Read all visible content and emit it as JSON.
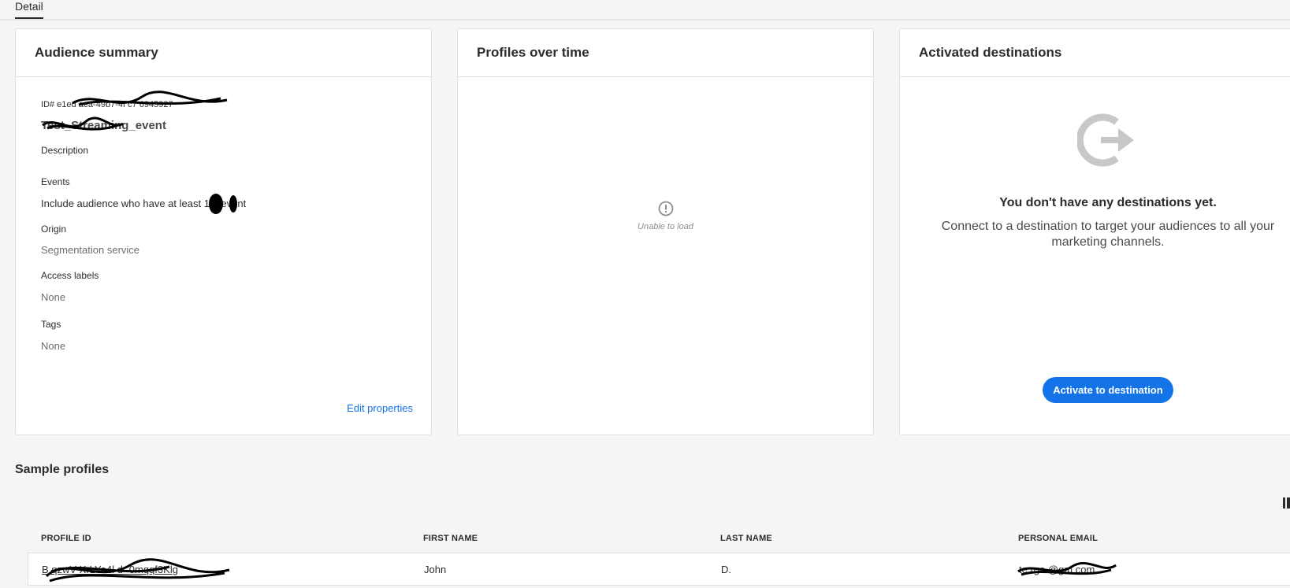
{
  "tabs": {
    "active": "Detail"
  },
  "audience_summary": {
    "title": "Audience summary",
    "id_text": "ID# e1ed    aea-49b7-4f    c7      6945927",
    "name": "       Test_Streaming_event",
    "description_label": "Description",
    "events_label": "Events",
    "events_value": "Include audience who have at least 1          g event",
    "origin_label": "Origin",
    "origin_value": "Segmentation service",
    "access_labels_label": "Access labels",
    "access_labels_value": "None",
    "tags_label": "Tags",
    "tags_value": "None",
    "edit_link": "Edit properties"
  },
  "profiles_over_time": {
    "title": "Profiles over time",
    "error_icon": "alert-circle-icon",
    "error_text": "Unable to load"
  },
  "activated_destinations": {
    "title": "Activated destinations",
    "icon": "destination-export-icon",
    "empty_title": "You don't have any destinations yet.",
    "empty_text": "Connect to a destination to target your audiences to all your marketing channels.",
    "activate_button": "Activate to destination"
  },
  "sample_profiles": {
    "title": "Sample profiles",
    "columns": [
      "PROFILE ID",
      "FIRST NAME",
      "LAST NAME",
      "PERSONAL EMAIL"
    ],
    "rows": [
      {
        "profile_id": "B    qzwV    XrLYa4l    d   -0mqqf3Klg",
        "first_name": "John",
        "last_name": "D.",
        "email": "te        rgo     @gm    com"
      }
    ]
  },
  "colors": {
    "accent": "#1473e6",
    "border": "#e1e1e1",
    "background": "#f5f5f5"
  }
}
